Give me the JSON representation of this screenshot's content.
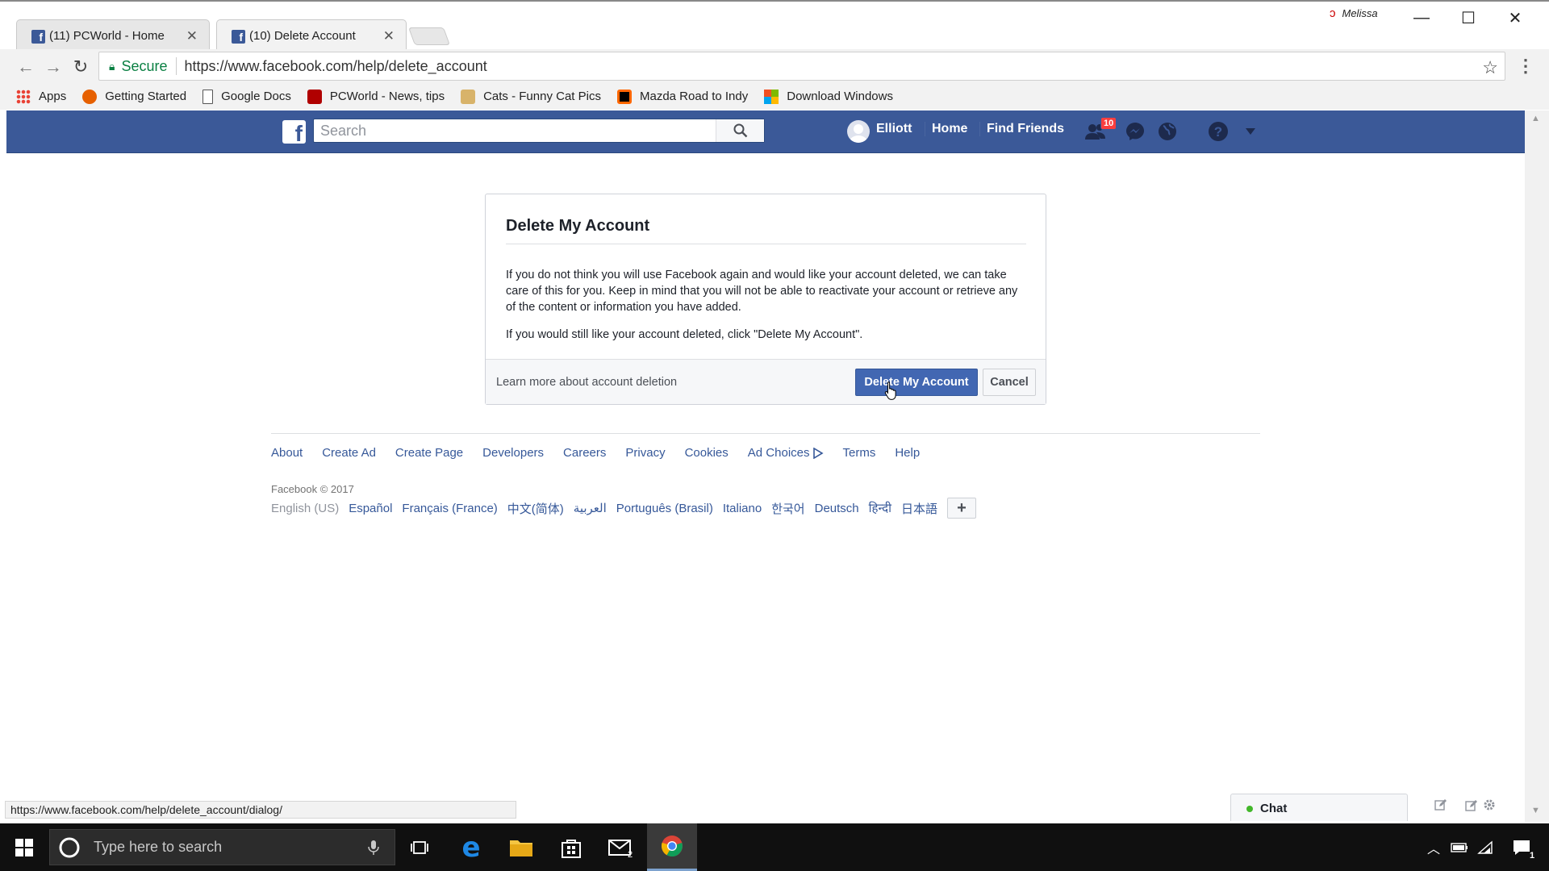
{
  "browser": {
    "tabs": [
      {
        "title": "(11) PCWorld - Home"
      },
      {
        "title": "(10) Delete Account"
      }
    ],
    "profile_name": "Melissa",
    "omnibox": {
      "secure_label": "Secure",
      "url": "https://www.facebook.com/help/delete_account"
    },
    "bookmarks": [
      {
        "label": "Apps",
        "icon": "apps-grid-icon",
        "color": "#e94235"
      },
      {
        "label": "Getting Started",
        "icon": "firefox-icon",
        "color": "#e66000"
      },
      {
        "label": "Google Docs",
        "icon": "document-icon",
        "color": "#ffffff"
      },
      {
        "label": "PCWorld - News, tips",
        "icon": "pcworld-icon",
        "color": "#b00000"
      },
      {
        "label": "Cats - Funny Cat Pics",
        "icon": "cat-icon",
        "color": "#d8b36a"
      },
      {
        "label": "Mazda Road to Indy",
        "icon": "mazda-icon",
        "color": "#000000"
      },
      {
        "label": "Download Windows",
        "icon": "windows-icon",
        "color": "#f25022"
      }
    ],
    "status_url": "https://www.facebook.com/help/delete_account/dialog/"
  },
  "facebook": {
    "search_placeholder": "Search",
    "user_name": "Elliott",
    "nav": {
      "home": "Home",
      "find_friends": "Find Friends"
    },
    "friend_requests_count": "10",
    "brand_color": "#3b5998"
  },
  "dialog": {
    "title": "Delete My Account",
    "paragraph1": "If you do not think you will use Facebook again and would like your account deleted, we can take care of this for you. Keep in mind that you will not be able to reactivate your account or retrieve any of the content or information you have added.",
    "paragraph2": "If you would still like your account deleted, click \"Delete My Account\".",
    "learn_more": "Learn more about account deletion",
    "delete_button": "Delete My Account",
    "cancel_button": "Cancel"
  },
  "footer": {
    "links": [
      "About",
      "Create Ad",
      "Create Page",
      "Developers",
      "Careers",
      "Privacy",
      "Cookies",
      "Ad Choices",
      "Terms",
      "Help"
    ],
    "copyright": "Facebook © 2017",
    "current_language": "English (US)",
    "languages": [
      "Español",
      "Français (France)",
      "中文(简体)",
      "العربية",
      "Português (Brasil)",
      "Italiano",
      "한국어",
      "Deutsch",
      "हिन्दी",
      "日本語"
    ]
  },
  "chat": {
    "label": "Chat"
  },
  "taskbar": {
    "search_placeholder": "Type here to search",
    "mail_badge": "2",
    "notification_count": "1"
  }
}
